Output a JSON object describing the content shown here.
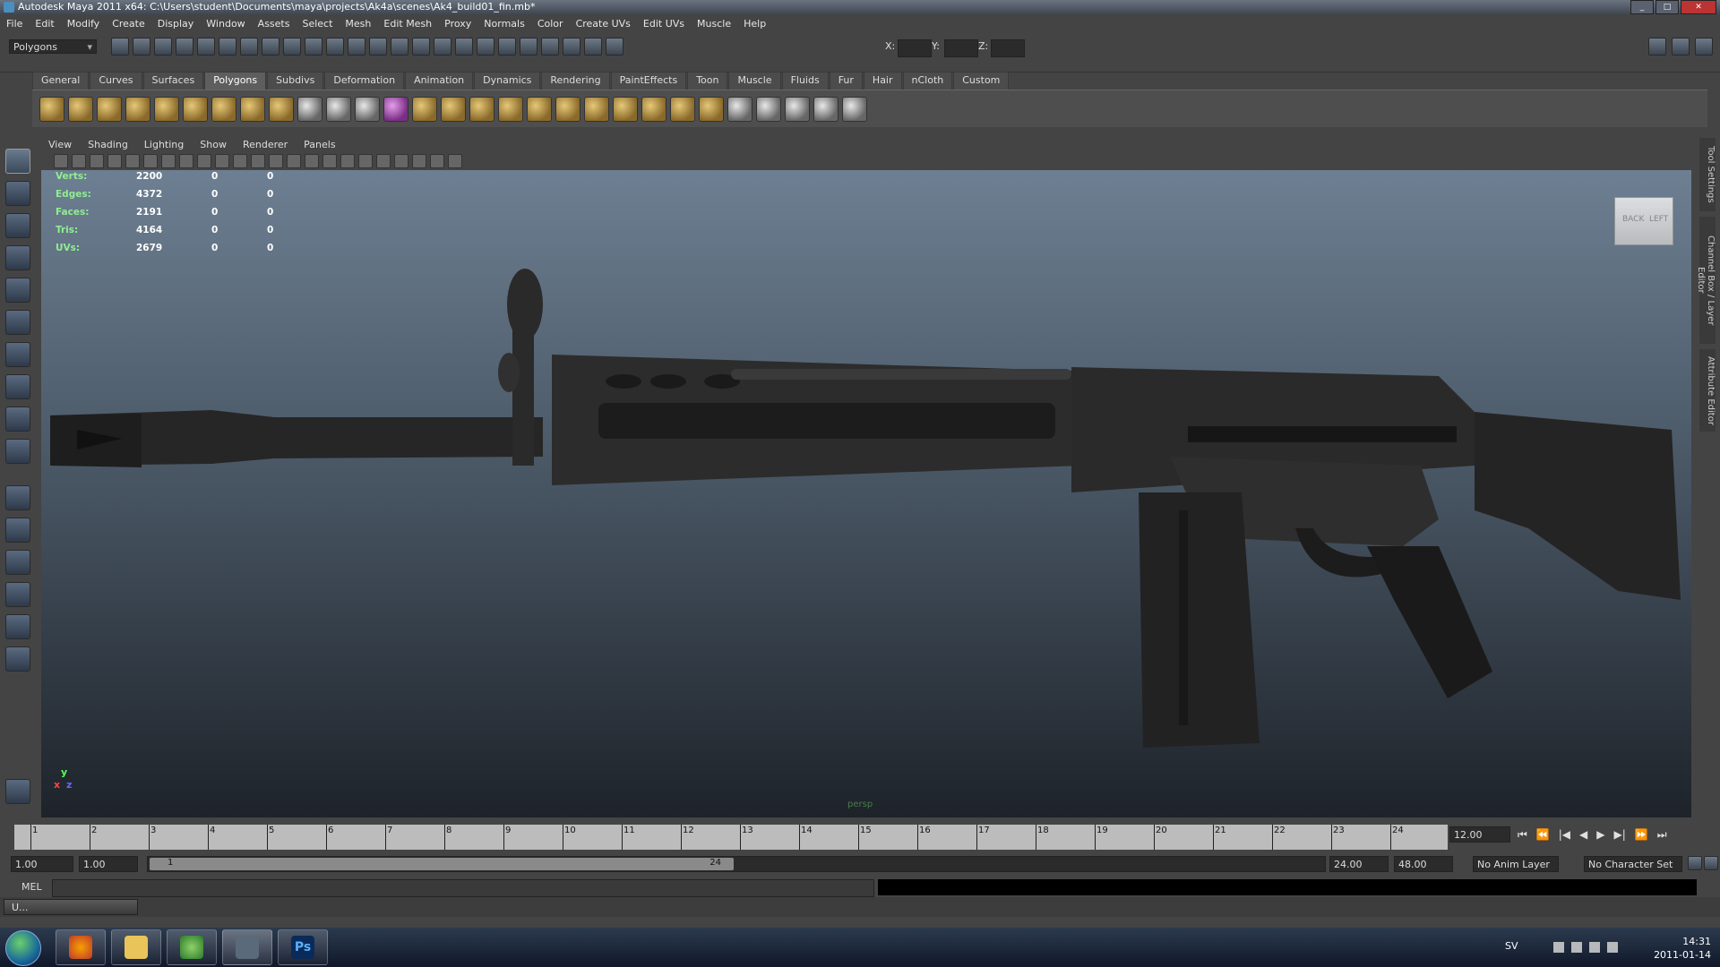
{
  "window": {
    "title": "Autodesk Maya 2011 x64: C:\\Users\\student\\Documents\\maya\\projects\\Ak4a\\scenes\\Ak4_build01_fin.mb*"
  },
  "menubar": [
    "File",
    "Edit",
    "Modify",
    "Create",
    "Display",
    "Window",
    "Assets",
    "Select",
    "Mesh",
    "Edit Mesh",
    "Proxy",
    "Normals",
    "Color",
    "Create UVs",
    "Edit UVs",
    "Muscle",
    "Help"
  ],
  "statusline": {
    "mode": "Polygons",
    "x_label": "X:",
    "y_label": "Y:",
    "z_label": "Z:"
  },
  "shelf": {
    "tabs": [
      "General",
      "Curves",
      "Surfaces",
      "Polygons",
      "Subdivs",
      "Deformation",
      "Animation",
      "Dynamics",
      "Rendering",
      "PaintEffects",
      "Toon",
      "Muscle",
      "Fluids",
      "Fur",
      "Hair",
      "nCloth",
      "Custom"
    ],
    "active_tab": "Polygons"
  },
  "panel": {
    "menu": [
      "View",
      "Shading",
      "Lighting",
      "Show",
      "Renderer",
      "Panels"
    ],
    "camera_label": "persp"
  },
  "hud": [
    {
      "label": "Verts:",
      "values": [
        "2200",
        "0",
        "0"
      ]
    },
    {
      "label": "Edges:",
      "values": [
        "4372",
        "0",
        "0"
      ]
    },
    {
      "label": "Faces:",
      "values": [
        "2191",
        "0",
        "0"
      ]
    },
    {
      "label": "Tris:",
      "values": [
        "4164",
        "0",
        "0"
      ]
    },
    {
      "label": "UVs:",
      "values": [
        "2679",
        "0",
        "0"
      ]
    }
  ],
  "viewcube": {
    "left_face": "BACK",
    "right_face": "LEFT"
  },
  "axis": {
    "y": "y",
    "x": "x",
    "z": "z"
  },
  "side_tabs": [
    "Tool Settings",
    "Channel Box / Layer Editor",
    "Attribute Editor"
  ],
  "timeline": {
    "ticks": [
      "1",
      "2",
      "3",
      "4",
      "5",
      "6",
      "7",
      "8",
      "9",
      "10",
      "11",
      "12",
      "13",
      "14",
      "15",
      "16",
      "17",
      "18",
      "19",
      "20",
      "21",
      "22",
      "23",
      "24"
    ],
    "current_frame": "12.00",
    "playback_buttons": [
      "⏮",
      "⏪",
      "|◀",
      "◀",
      "▶",
      "▶|",
      "⏩",
      "⏭"
    ]
  },
  "range": {
    "start": "1.00",
    "anim_start": "1.00",
    "slider_start": "1",
    "slider_end": "24",
    "anim_end": "24.00",
    "end": "48.00",
    "anim_layer": "No Anim Layer",
    "character_set": "No Character Set"
  },
  "cmdline": {
    "label": "MEL"
  },
  "helpline": {
    "minimized_label": "U..."
  },
  "taskbar": {
    "language": "SV",
    "time": "14:31",
    "date": "2011-01-14",
    "ps_label": "Ps"
  },
  "colors": {
    "hud_label": "#90ee90",
    "viewport_top": "#6d7f92",
    "viewport_bottom": "#1e232a"
  }
}
